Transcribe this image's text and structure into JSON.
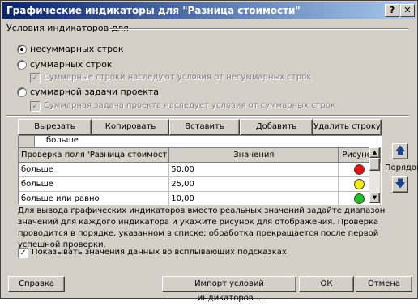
{
  "window": {
    "title": "Графические индикаторы для \"Разница стоимости\"",
    "help_btn": "?",
    "close_btn": "✕"
  },
  "conditions": {
    "heading": "Условия индикаторов для",
    "radio_nonsummary": "несуммарных строк",
    "radio_summary": "суммарных строк",
    "check_summary_inherit": "Суммарные строки наследуют условия от несуммарных строк",
    "radio_project_summary": "суммарной задачи проекта",
    "check_project_inherit": "Суммарная задача проекта наследует условия от суммарных строк"
  },
  "toolbar": {
    "cut_row": "Вырезать строку",
    "copy_row": "Копировать строку",
    "paste_row": "Вставить строку",
    "add_row": "Добавить строку",
    "delete_row": "Удалить строку"
  },
  "grid": {
    "edit_value": "больше",
    "columns": [
      "Проверка поля 'Разница стоимост",
      "Значения",
      "Рисунок"
    ],
    "rows": [
      {
        "test": "больше",
        "value": "50,00",
        "icon": "red-circle-icon",
        "color": "#e81010"
      },
      {
        "test": "больше",
        "value": "25,00",
        "icon": "yellow-circle-icon",
        "color": "#f4ec10"
      },
      {
        "test": "больше или равно",
        "value": "10,00",
        "icon": "green-circle-icon",
        "color": "#20c020"
      }
    ]
  },
  "order_label": "Порядок",
  "description": "Для вывода графических индикаторов вместо реальных значений задайте диапазон значений для каждого индикатора и укажите рисунок для отображения. Проверка проводится в порядке, указанном в списке; обработка прекращается после первой успешной проверки.",
  "tooltip_check": "Показывать значения данных во всплывающих подсказках",
  "footer": {
    "help": "Справка",
    "import": "Импорт условий индикаторов...",
    "ok": "ОК",
    "cancel": "Отмена"
  }
}
